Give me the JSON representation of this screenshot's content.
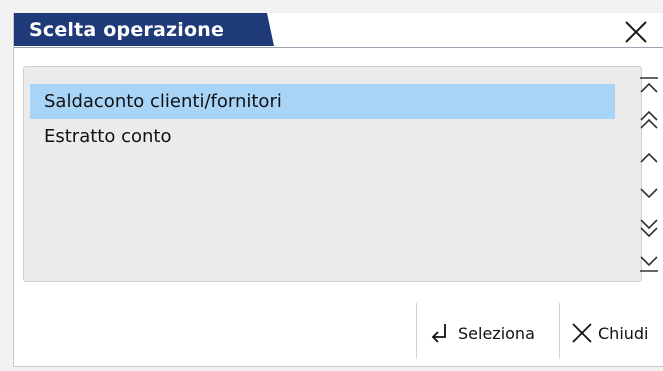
{
  "dialog": {
    "title": "Scelta operazione",
    "title_color": "#1e3a78",
    "close_icon": "close-icon"
  },
  "list": {
    "items": [
      {
        "label": "Saldaconto clienti/fornitori",
        "selected": true
      },
      {
        "label": "Estratto conto",
        "selected": false
      }
    ],
    "selected_color": "#a8d4f7"
  },
  "scrollbar": {
    "buttons": [
      "scroll-top-icon",
      "page-up-icon",
      "line-up-icon",
      "line-down-icon",
      "page-down-icon",
      "scroll-bottom-icon"
    ]
  },
  "footer": {
    "select_label": "Seleziona",
    "select_icon": "enter-return-icon",
    "close_label": "Chiudi",
    "close_icon": "close-icon"
  }
}
